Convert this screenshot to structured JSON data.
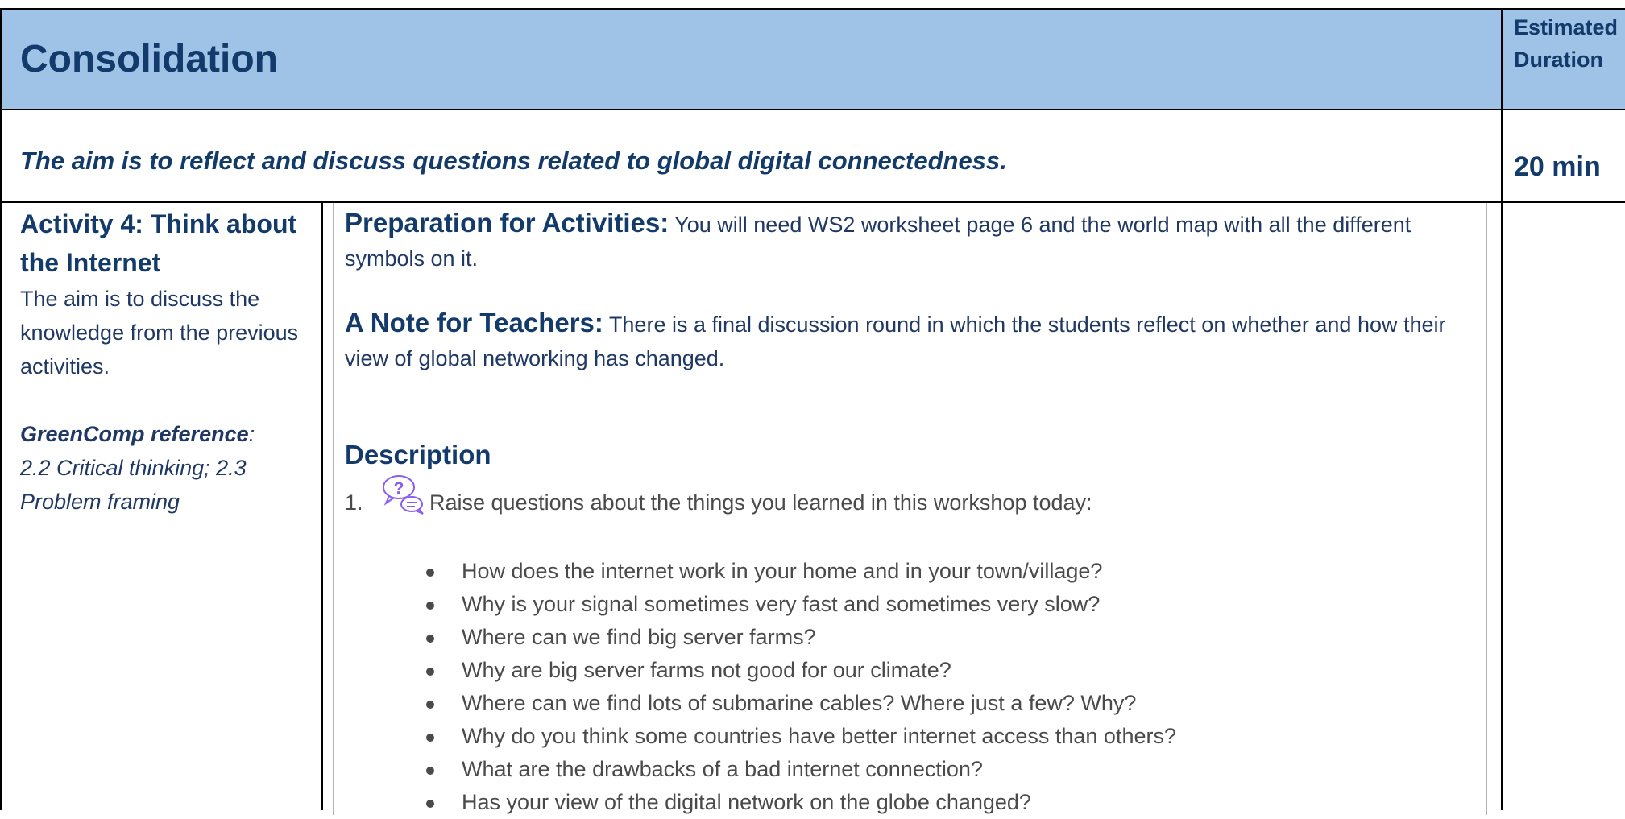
{
  "header": {
    "title": "Consolidation",
    "duration_label": "Estimated Duration",
    "aim": "The aim is to reflect and discuss questions related to global digital connectedness.",
    "duration_value": "20 min"
  },
  "activity": {
    "title": "Activity 4:  Think about the Internet",
    "description": "The aim is to discuss the knowledge from the previous activities.",
    "greencomp_label": "GreenComp reference",
    "greencomp_colon": ":",
    "greencomp_value": "2.2 Critical thinking; 2.3 Problem framing"
  },
  "preparation": {
    "heading": "Preparation for Activities:",
    "text": "You will need WS2 worksheet page 6 and the world map with all the different symbols on it."
  },
  "note": {
    "heading": "A Note for Teachers:",
    "text": "There is a final discussion round in which the students reflect on whether and how their view of global networking has changed."
  },
  "description": {
    "heading": "Description",
    "step_number": "1.",
    "step_icon": "question-discussion-icon",
    "step_text": "Raise questions about the things you learned in this workshop today:",
    "questions": [
      "How does the internet work in your home and in your town/village?",
      "Why is your signal sometimes very fast and sometimes very slow?",
      "Where can we find big server farms?",
      "Why are big server farms not good for our climate?",
      "Where can we find lots of submarine cables? Where just a few? Why?",
      "Why do you think some countries have better internet access than others?",
      "What are the drawbacks of a bad internet connection?",
      "Has your view of the digital network on the globe changed?"
    ]
  },
  "colors": {
    "header_bg": "#9fc3e6",
    "heading_text": "#123a6a",
    "body_text": "#1f3864",
    "question_text": "#4a4a4a",
    "icon": "#8a5cf0"
  }
}
